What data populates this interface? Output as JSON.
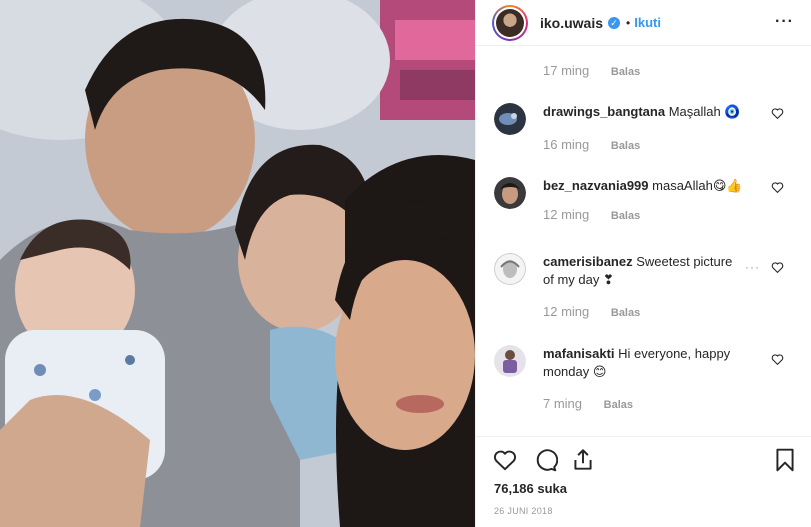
{
  "post": {
    "username": "iko.uwais",
    "verified_mark": "✓",
    "separator": "•",
    "follow_label": "Ikuti",
    "more_label": "···",
    "likes_text": "76,186 suka",
    "date_text": "26 JUNI 2018"
  },
  "comments": [
    {
      "meta": {
        "time": "17 ming",
        "reply": "Balas"
      }
    },
    {
      "username": "drawings_bangtana",
      "text": "Maşallah 🧿",
      "time": "16 ming",
      "reply": "Balas",
      "avatar_color": "#2b3440"
    },
    {
      "username": "bez_nazvania999",
      "text": "masaAllah😋👍",
      "time": "12 ming",
      "reply": "Balas",
      "avatar_color": "#3a3a3a"
    },
    {
      "username": "camerisibanez",
      "text": "Sweetest picture of my day ❣",
      "time": "12 ming",
      "reply": "Balas",
      "more": "···",
      "avatar_color": "#d9d9d9"
    },
    {
      "username": "mafanisakti",
      "text": "Hi everyone, happy monday 😊",
      "time": "7 ming",
      "reply": "Balas",
      "avatar_color": "#6a5a8a"
    }
  ],
  "icons": {
    "like": "heart-icon",
    "comment": "comment-icon",
    "share": "share-icon",
    "save": "bookmark-icon",
    "verified": "verified-badge-icon",
    "more": "more-options-icon"
  },
  "colors": {
    "accent": "#3897f0",
    "text": "#262626",
    "muted": "#999999",
    "border": "#efefef"
  }
}
